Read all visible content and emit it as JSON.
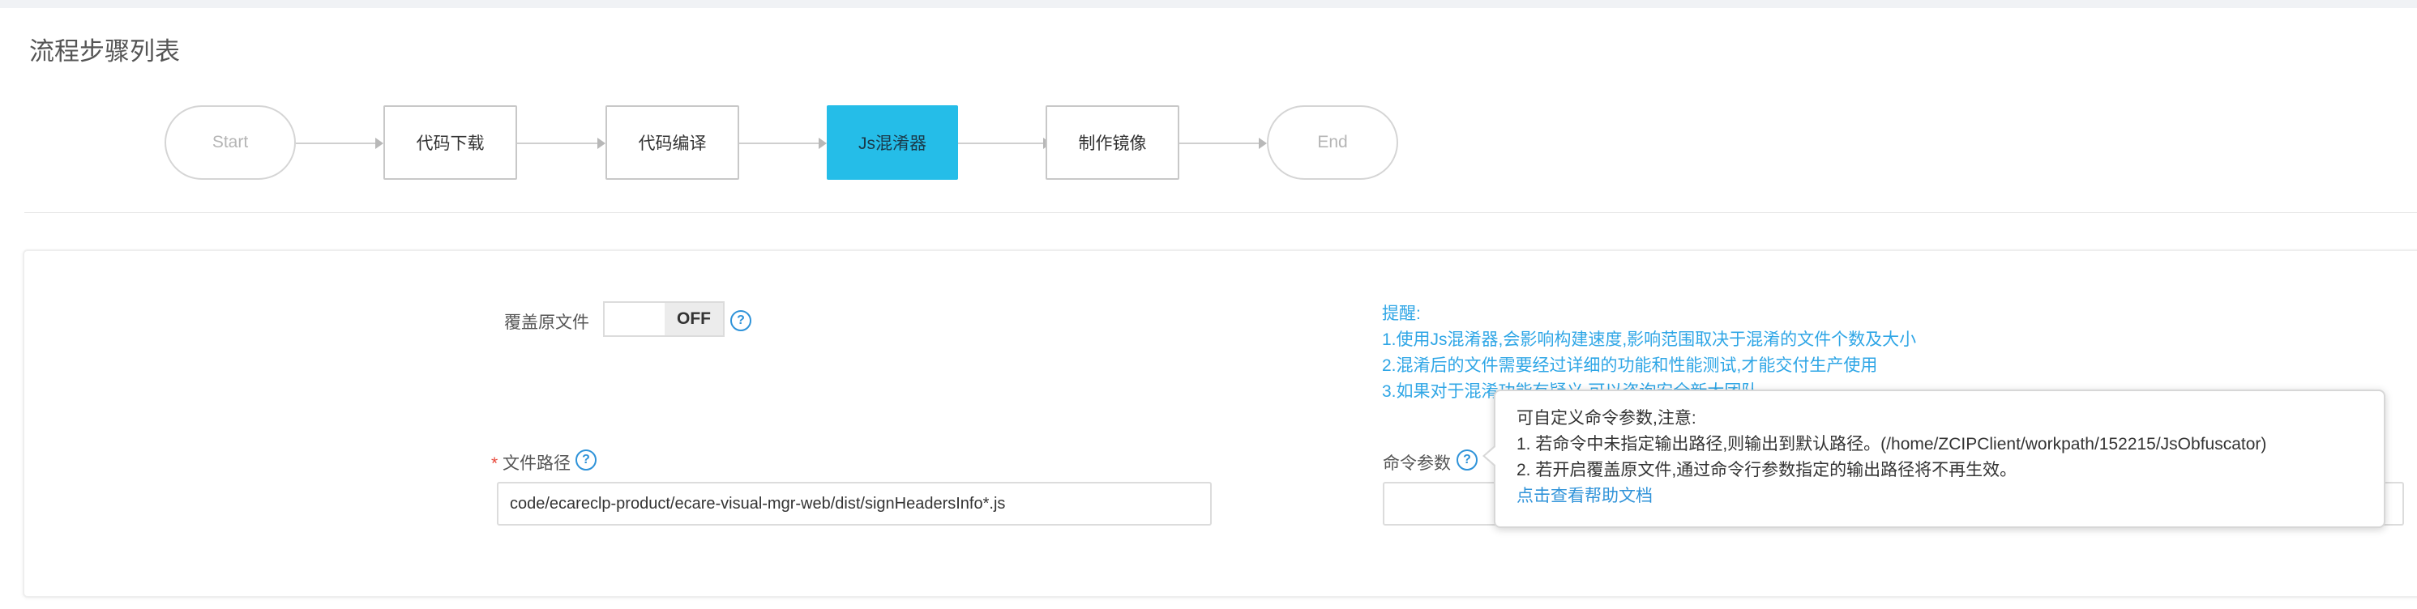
{
  "section_title": "流程步骤列表",
  "flow": {
    "steps": [
      {
        "label": "Start",
        "kind": "terminal",
        "state": "inactive"
      },
      {
        "label": "代码下载",
        "kind": "step",
        "state": "normal"
      },
      {
        "label": "代码编译",
        "kind": "step",
        "state": "normal"
      },
      {
        "label": "Js混淆器",
        "kind": "step",
        "state": "active"
      },
      {
        "label": "制作镜像",
        "kind": "step",
        "state": "normal"
      },
      {
        "label": "End",
        "kind": "terminal",
        "state": "inactive"
      }
    ]
  },
  "form": {
    "overwrite": {
      "label": "覆盖原文件",
      "toggle_text": "OFF",
      "help": "?"
    },
    "tips": {
      "title": "提醒:",
      "lines": [
        "1.使用Js混淆器,会影响构建速度,影响范围取决于混淆的文件个数及大小",
        "2.混淆后的文件需要经过详细的功能和性能测试,才能交付生产使用",
        "3.如果对于混淆功能有疑义,可以咨询安全新大团队"
      ]
    },
    "file_path": {
      "required_mark": "*",
      "label": "文件路径",
      "help": "?",
      "value": "code/ecareclp-product/ecare-visual-mgr-web/dist/signHeadersInfo*.js"
    },
    "command_params": {
      "label": "命令参数",
      "help": "?",
      "value": ""
    }
  },
  "tooltip": {
    "title": "可自定义命令参数,注意:",
    "line1": "1. 若命令中未指定输出路径,则输出到默认路径。(/home/ZCIPClient/workpath/152215/JsObfuscator)",
    "line2": "2. 若开启覆盖原文件,通过命令行参数指定的输出路径将不再生效。",
    "link": "点击查看帮助文档"
  },
  "colors": {
    "active_step": "#25bde8",
    "tip_text": "#2fa6e6",
    "help_icon": "#2f93d9"
  }
}
